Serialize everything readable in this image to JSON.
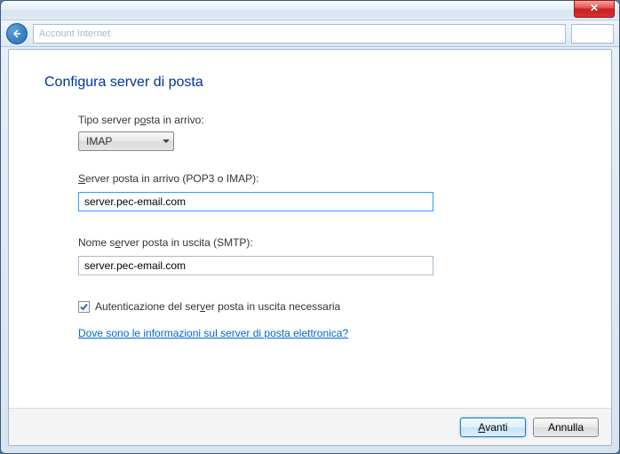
{
  "titlebar": {
    "close_glyph": "✕"
  },
  "toolbar": {
    "address_placeholder": "Account Internet"
  },
  "heading": "Configura server di posta",
  "labels": {
    "server_type_pre": "Tipo server p",
    "server_type_u": "o",
    "server_type_post": "sta in arrivo:",
    "incoming_u": "S",
    "incoming_post": "erver posta in arrivo (POP3 o IMAP):",
    "outgoing_pre": "Nome s",
    "outgoing_u": "e",
    "outgoing_post": "rver posta in uscita (SMTP):",
    "auth_pre": "Autenticazione del ser",
    "auth_u": "v",
    "auth_post": "er posta in uscita necessaria"
  },
  "values": {
    "server_type": "IMAP",
    "incoming_server": "server.pec-email.com",
    "outgoing_server": "server.pec-email.com",
    "auth_checked": true
  },
  "link_pre": "Dove sono le informa",
  "link_u": "z",
  "link_post": "ioni sul server di posta elettronica?",
  "buttons": {
    "next_u": "A",
    "next_post": "vanti",
    "cancel": "Annulla"
  }
}
